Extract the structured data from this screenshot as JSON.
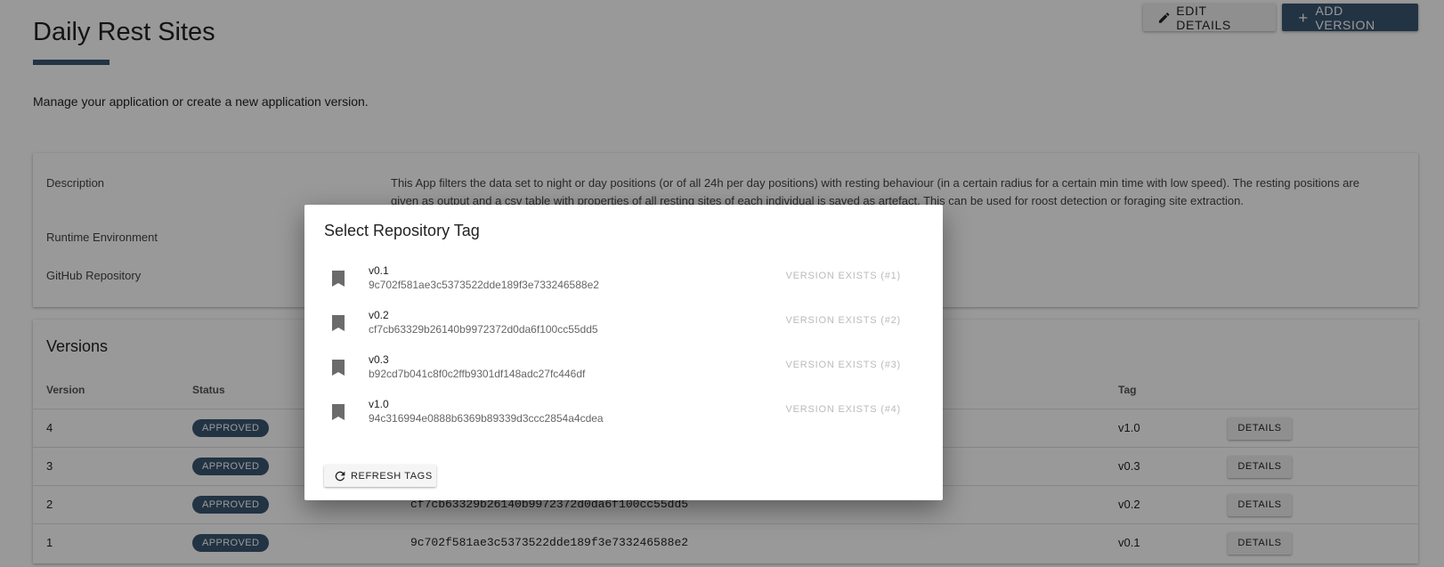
{
  "header": {
    "edit_label": "EDIT DETAILS",
    "add_label": "ADD VERSION"
  },
  "page": {
    "title": "Daily Rest Sites",
    "subtitle": "Manage your application or create a new application version."
  },
  "info": {
    "description_label": "Description",
    "description_value": "This App filters the data set to night or day positions (or of all 24h per day positions) with resting behaviour (in a certain radius for a certain min time with low speed). The resting positions are given as output and a csv table with properties of all resting sites of each individual is saved as artefact. This can be used for roost detection or foraging site extraction.",
    "runtime_label": "Runtime Environment",
    "github_label": "GitHub Repository"
  },
  "versions": {
    "title": "Versions",
    "columns": {
      "version": "Version",
      "status": "Status",
      "tag": "Tag"
    },
    "rows": [
      {
        "version": "4",
        "status": "APPROVED",
        "commit": "",
        "tag": "v1.0",
        "action": "DETAILS"
      },
      {
        "version": "3",
        "status": "APPROVED",
        "commit": "",
        "tag": "v0.3",
        "action": "DETAILS"
      },
      {
        "version": "2",
        "status": "APPROVED",
        "commit": "cf7cb63329b26140b9972372d0da6f100cc55dd5",
        "tag": "v0.2",
        "action": "DETAILS"
      },
      {
        "version": "1",
        "status": "APPROVED",
        "commit": "9c702f581ae3c5373522dde189f3e733246588e2",
        "tag": "v0.1",
        "action": "DETAILS"
      }
    ]
  },
  "dialog": {
    "title": "Select Repository Tag",
    "tags": [
      {
        "name": "v0.1",
        "sha": "9c702f581ae3c5373522dde189f3e733246588e2",
        "status": "VERSION EXISTS (#1)"
      },
      {
        "name": "v0.2",
        "sha": "cf7cb63329b26140b9972372d0da6f100cc55dd5",
        "status": "VERSION EXISTS (#2)"
      },
      {
        "name": "v0.3",
        "sha": "b92cd7b041c8f0c2ffb9301df148adc27fc446df",
        "status": "VERSION EXISTS (#3)"
      },
      {
        "name": "v1.0",
        "sha": "94c316994e0888b6369b89339d3ccc2854a4cdea",
        "status": "VERSION EXISTS (#4)"
      }
    ],
    "refresh_label": "REFRESH TAGS"
  },
  "colors": {
    "accent": "#3a5670",
    "overlay": "rgba(0,0,0,0.4)"
  },
  "icons": [
    "pencil-icon",
    "plus-icon",
    "bookmark-icon",
    "refresh-icon"
  ]
}
